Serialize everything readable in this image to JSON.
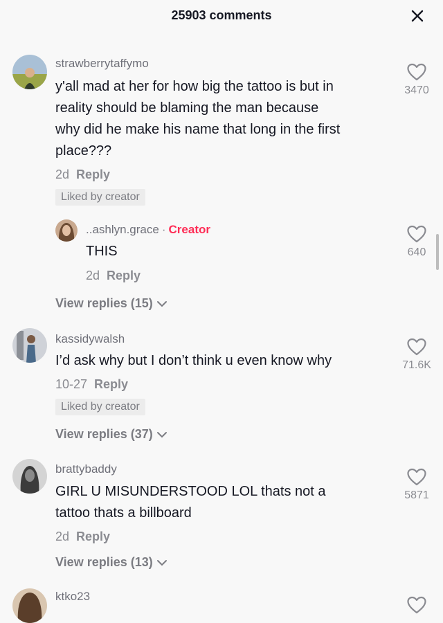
{
  "header": {
    "title": "25903 comments"
  },
  "comments": [
    {
      "username": "strawberrytaffymo",
      "text_lines": [
        "y'all mad at her for how big the tattoo is but in",
        "reality should be blaming the man because",
        "why did he make his name that long in the first",
        "place???"
      ],
      "date": "2d",
      "reply_label": "Reply",
      "liked_label": "Liked by creator",
      "likes": "3470",
      "reply": {
        "username": "..ashlyn.grace",
        "separator": "·",
        "creator_label": "Creator",
        "text": "THIS",
        "date": "2d",
        "reply_label": "Reply",
        "likes": "640"
      },
      "view_replies": "View replies (15)"
    },
    {
      "username": "kassidywalsh",
      "text_lines": [
        "I’d ask why but I don’t think u even know why"
      ],
      "date": "10-27",
      "reply_label": "Reply",
      "liked_label": "Liked by creator",
      "likes": "71.6K",
      "view_replies": "View replies (37)"
    },
    {
      "username": "brattybaddy",
      "text_lines": [
        "GIRL U MISUNDERSTOOD LOL thats not a",
        "tattoo thats a billboard"
      ],
      "date": "2d",
      "reply_label": "Reply",
      "likes": "5871",
      "view_replies": "View replies (13)"
    },
    {
      "username": "ktko23"
    }
  ],
  "icons": {
    "close": "close-icon",
    "heart": "heart-outline-icon",
    "chevron": "chevron-down-icon"
  },
  "colors": {
    "creator": "#fe2c55",
    "text": "#161823",
    "muted": "#8a8b91",
    "background": "#f8f8f8"
  }
}
